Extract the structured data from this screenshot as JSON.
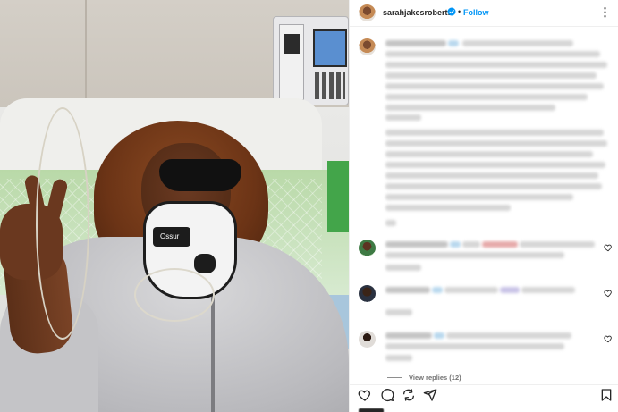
{
  "post": {
    "username": "sarahjakesroberts",
    "verified": true,
    "separator": "•",
    "follow_label": "Follow",
    "more_label": "⋮",
    "image_alt_brand": "Ossur"
  },
  "comments": {
    "view_replies_label": "View replies (12)"
  },
  "actions": {
    "icons": [
      "heart-icon",
      "comment-icon",
      "share-icon",
      "send-icon",
      "bookmark-icon"
    ]
  },
  "colors": {
    "follow_blue": "#0095f6",
    "verified_blue": "#0095f6",
    "text": "#262626",
    "muted": "#737373"
  }
}
